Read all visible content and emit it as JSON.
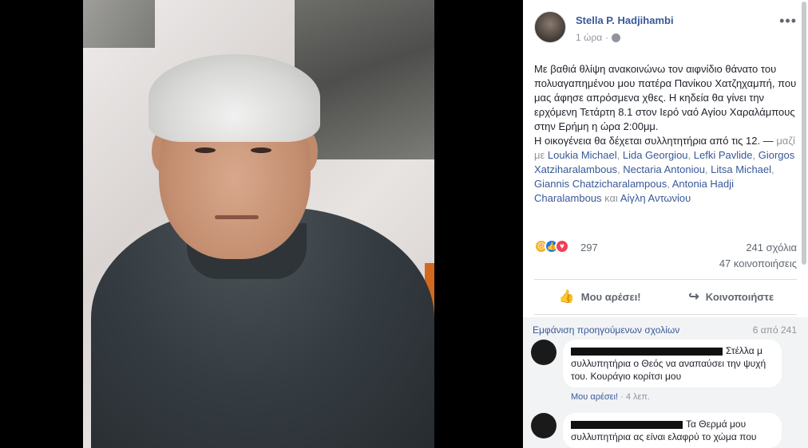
{
  "post": {
    "author": "Stella P. Hadjihambi",
    "time": "1 ώρα",
    "text_main": "Με βαθιά θλίψη ανακοινώνω τον αιφνίδιο θάνατο του πολυαγαπημένου μου πατέρα Πανίκου Χατζηχαμπή, που μας άφησε απρόσμενα χθες. Η κηδεία θα γίνει την ερχόμενη Τετάρτη 8.1 στον Ιερό ναό Αγίου Χαραλάμπους στην Ερήμη η ώρα 2:00μμ.",
    "text_second": "Η οικογένεια θα δέχεται συλλητητήρια από τις 12. — ",
    "with_label": "μαζί με ",
    "tagged": [
      "Loukia Michael",
      "Lida Georgiou",
      "Lefki Pavlide",
      "Giorgos Xatziharalambous",
      "Nectaria Antoniou",
      "Litsa Michael",
      "Giannis Chatzicharalampous",
      "Antonia Hadji Charalambous"
    ],
    "and_label": "και",
    "last_tagged": "Αίγλη Αντωνίου"
  },
  "reactions": {
    "count": "297",
    "comments": "241 σχόλια",
    "shares": "47 κοινοποιήσεις",
    "icons": [
      "sad-icon",
      "like-icon",
      "love-icon"
    ]
  },
  "actions": {
    "like": "Μου αρέσει!",
    "share": "Κοινοποιήστε"
  },
  "comments": {
    "previous_link": "Εμφάνιση προηγούμενων σχολίων",
    "page_count": "6 από 241",
    "items": [
      {
        "text": "Στέλλα μ συλλυπητήρια ο Θεός να αναπαύσει την ψυχή του. Κουράγιο κορίτσι μου",
        "like": "Μου αρέσει!",
        "sep": " · ",
        "time": "4 λεπ."
      },
      {
        "text": "Τα Θερμά μου συλλυπητήρια ας είναι ελαφρύ το χώμα που"
      }
    ]
  },
  "colors": {
    "link": "#385898",
    "muted": "#90949c",
    "comment_bg": "#f2f3f5"
  }
}
